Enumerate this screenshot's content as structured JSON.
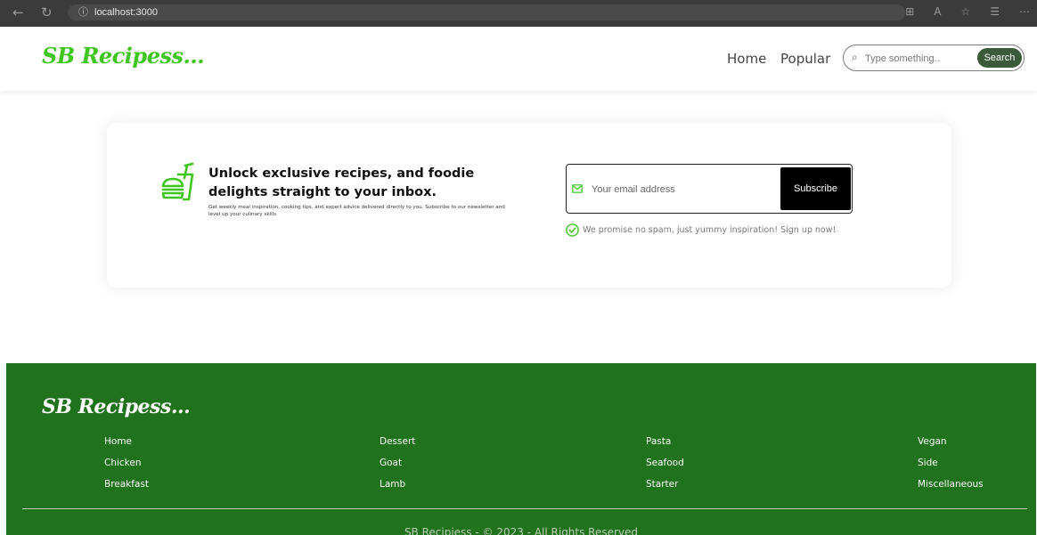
{
  "browser": {
    "url": "localhost:3000"
  },
  "navbar": {
    "logo": "SB Recipess...",
    "links": [
      "Home",
      "Popular"
    ],
    "search_placeholder": "Type something..",
    "search_button": "Search"
  },
  "newsletter": {
    "title": "Unlock exclusive recipes, and foodie delights straight to your inbox.",
    "description": "Get weekly meal inspiration, cooking tips, and expert advice delivered directly to you. Subscribe to our newsletter and level up your culinary skills",
    "email_placeholder": "Your email address",
    "subscribe_button": "Subscribe",
    "promise": "We promise no spam, just yummy inspiration! Sign up now!"
  },
  "footer": {
    "logo": "SB Recipess...",
    "columns": [
      [
        "Home",
        "Chicken",
        "Breakfast"
      ],
      [
        "Dessert",
        "Goat",
        "Lamb"
      ],
      [
        "Pasta",
        "Seafood",
        "Starter"
      ],
      [
        "Vegan",
        "Side",
        "Miscellaneous"
      ]
    ],
    "copyright": "SB Recipiess - © 2023 - All Rights Reserved"
  },
  "colors": {
    "brand_green": "#3ec61f",
    "footer_green": "#20731c",
    "search_button": "#3a5a3a"
  }
}
